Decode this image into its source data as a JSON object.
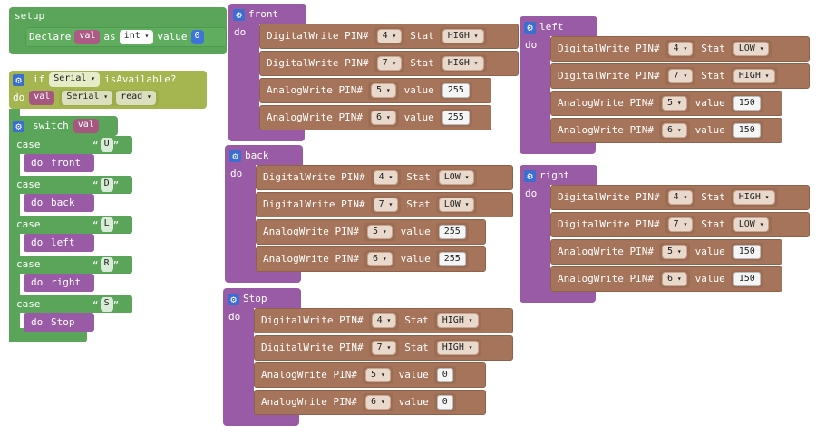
{
  "setup": {
    "hat_label": "setup",
    "declare_label": "Declare",
    "var_name": "val",
    "as_label": "as",
    "type_value": "int",
    "value_label": "value",
    "init_value": "0"
  },
  "loop_block": {
    "if_label": "if",
    "serial_value": "Serial",
    "is_available_label": "isAvailable?",
    "do_label": "do",
    "val_var": "val",
    "serial_read_value": "Serial",
    "read_value": "read",
    "switch_label": "switch",
    "switch_var": "val",
    "case_label": "case",
    "cases": [
      {
        "char": "U",
        "call": "front"
      },
      {
        "char": "D",
        "call": "back"
      },
      {
        "char": "L",
        "call": "left"
      },
      {
        "char": "R",
        "call": "right"
      },
      {
        "char": "S",
        "call": "Stop"
      }
    ],
    "call_do_label": "do"
  },
  "labels": {
    "digital_write": "DigitalWrite PIN#",
    "analog_write": "AnalogWrite PIN#",
    "stat": "Stat",
    "value": "value",
    "do": "do"
  },
  "functions": [
    {
      "name": "front",
      "digital": [
        {
          "pin": "4",
          "stat": "HIGH"
        },
        {
          "pin": "7",
          "stat": "HIGH"
        }
      ],
      "analog": [
        {
          "pin": "5",
          "value": "255"
        },
        {
          "pin": "6",
          "value": "255"
        }
      ]
    },
    {
      "name": "back",
      "digital": [
        {
          "pin": "4",
          "stat": "LOW"
        },
        {
          "pin": "7",
          "stat": "LOW"
        }
      ],
      "analog": [
        {
          "pin": "5",
          "value": "255"
        },
        {
          "pin": "6",
          "value": "255"
        }
      ]
    },
    {
      "name": "Stop",
      "digital": [
        {
          "pin": "4",
          "stat": "HIGH"
        },
        {
          "pin": "7",
          "stat": "HIGH"
        }
      ],
      "analog": [
        {
          "pin": "5",
          "value": "0"
        },
        {
          "pin": "6",
          "value": "0"
        }
      ]
    },
    {
      "name": "left",
      "digital": [
        {
          "pin": "4",
          "stat": "LOW"
        },
        {
          "pin": "7",
          "stat": "HIGH"
        }
      ],
      "analog": [
        {
          "pin": "5",
          "value": "150"
        },
        {
          "pin": "6",
          "value": "150"
        }
      ]
    },
    {
      "name": "right",
      "digital": [
        {
          "pin": "4",
          "stat": "HIGH"
        },
        {
          "pin": "7",
          "stat": "LOW"
        }
      ],
      "analog": [
        {
          "pin": "5",
          "value": "150"
        },
        {
          "pin": "6",
          "value": "150"
        }
      ]
    }
  ],
  "icons": {
    "gear": "gear-icon",
    "dropdown": "chevron-down-icon"
  },
  "colors": {
    "setup_green": "#5ba55b",
    "serial_olive": "#a5b54f",
    "function_purple": "#995ba5",
    "io_brown": "#a5745b",
    "variable_plum": "#a5577f",
    "gear_blue": "#3b6ed0"
  }
}
